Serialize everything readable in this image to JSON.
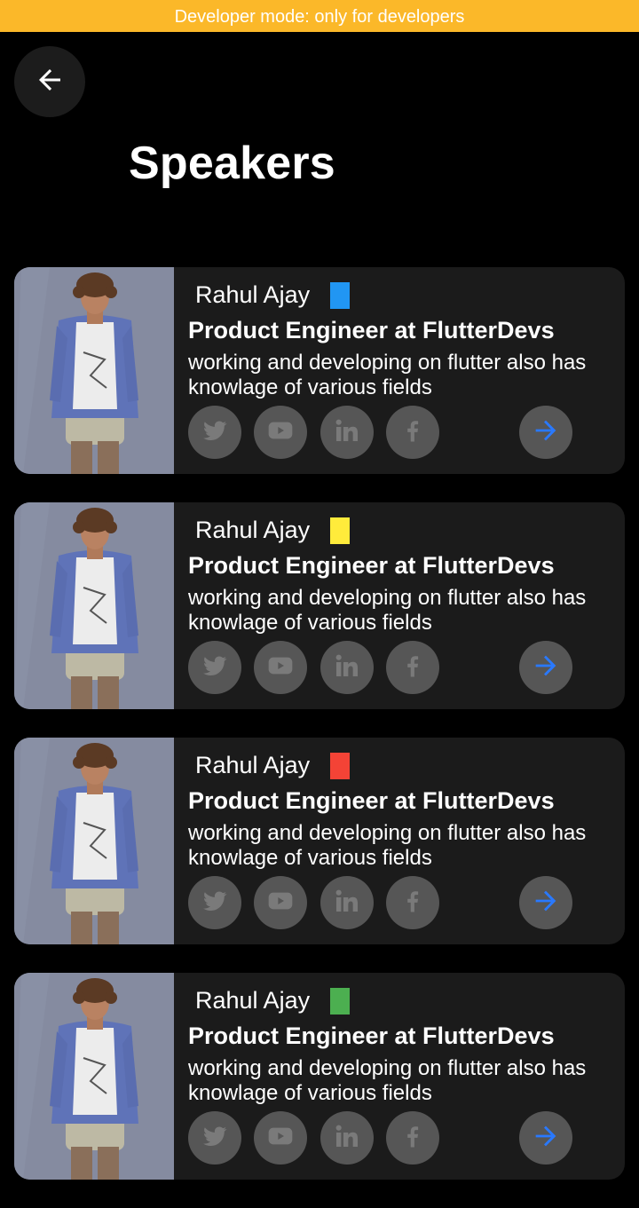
{
  "banner": {
    "text": "Developer mode: only for developers"
  },
  "header": {
    "title": "Speakers",
    "back_icon": "arrow-left-icon"
  },
  "colors": {
    "banner_bg": "#fbb829",
    "card_bg": "#1b1b1b",
    "icon_circle": "#565656",
    "icon_fg": "#7a7a7a",
    "arrow_accent": "#2979ff"
  },
  "speakers": [
    {
      "name": "Rahul Ajay",
      "tag_color": "#2196f3",
      "role": "Product Engineer at FlutterDevs",
      "bio_line1": "working and developing on flutter also has",
      "bio_line2": "knowlage of various fields",
      "icons": [
        "twitter-icon",
        "youtube-icon",
        "linkedin-icon",
        "facebook-icon",
        "arrow-right-icon"
      ]
    },
    {
      "name": "Rahul Ajay",
      "tag_color": "#ffeb3b",
      "role": "Product Engineer at FlutterDevs",
      "bio_line1": "working and developing on flutter also has",
      "bio_line2": "knowlage of various fields",
      "icons": [
        "twitter-icon",
        "youtube-icon",
        "linkedin-icon",
        "facebook-icon",
        "arrow-right-icon"
      ]
    },
    {
      "name": "Rahul Ajay",
      "tag_color": "#f44336",
      "role": "Product Engineer at FlutterDevs",
      "bio_line1": "working and developing on flutter also has",
      "bio_line2": "knowlage of various fields",
      "icons": [
        "twitter-icon",
        "youtube-icon",
        "linkedin-icon",
        "facebook-icon",
        "arrow-right-icon"
      ]
    },
    {
      "name": "Rahul Ajay",
      "tag_color": "#4caf50",
      "role": "Product Engineer at FlutterDevs",
      "bio_line1": "working and developing on flutter also has",
      "bio_line2": "knowlage of various fields",
      "icons": [
        "twitter-icon",
        "youtube-icon",
        "linkedin-icon",
        "facebook-icon",
        "arrow-right-icon"
      ]
    }
  ]
}
